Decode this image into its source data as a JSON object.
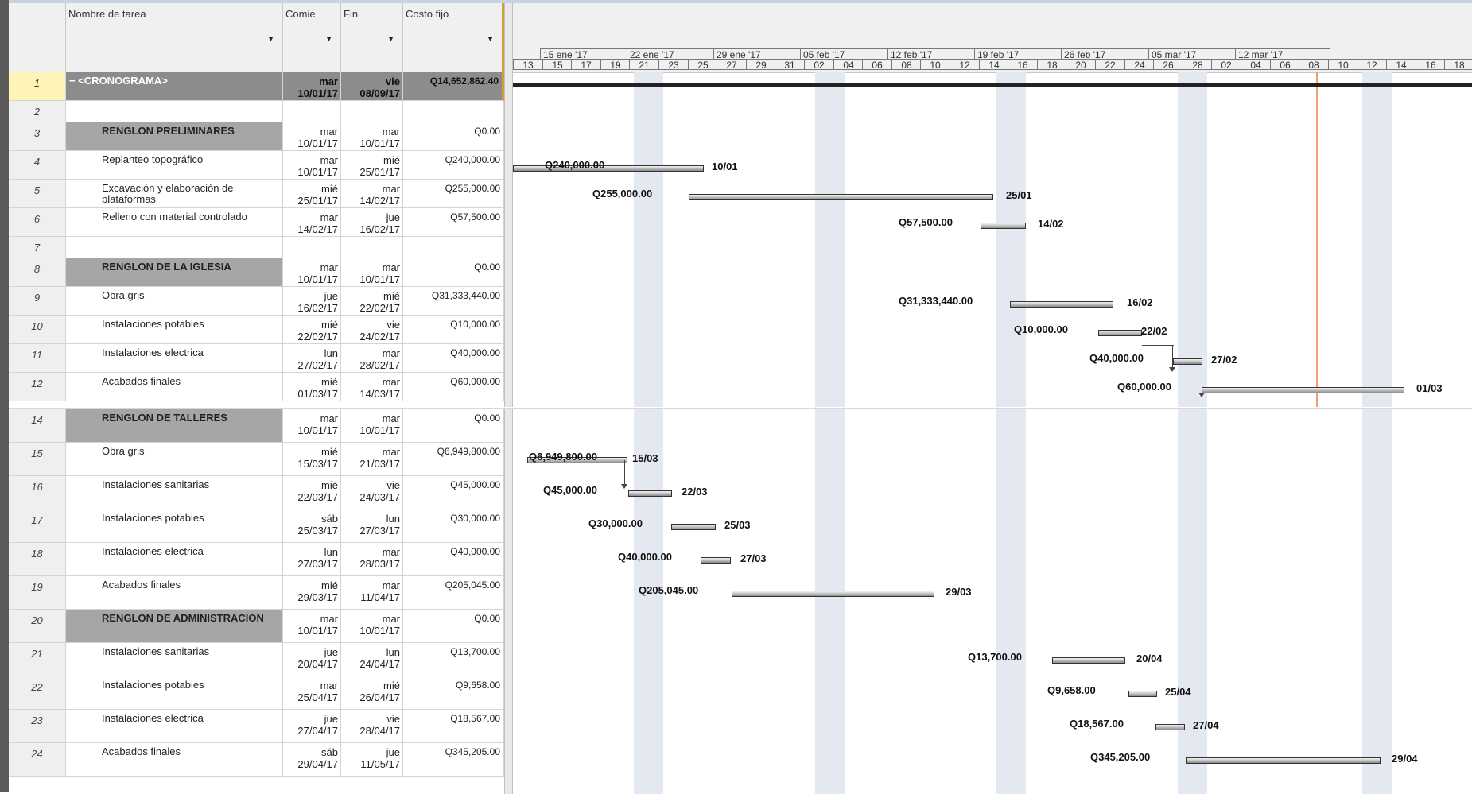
{
  "columns": {
    "name": "Nombre de tarea",
    "start": "Comie",
    "end": "Fin",
    "cost": "Costo fijo"
  },
  "timescale": {
    "weeks": [
      "15 ene '17",
      "22 ene '17",
      "29 ene '17",
      "05 feb '17",
      "12 feb '17",
      "19 feb '17",
      "26 feb '17",
      "05 mar '17",
      "12 mar '17"
    ],
    "days": [
      "13",
      "15",
      "17",
      "19",
      "21",
      "23",
      "25",
      "27",
      "29",
      "31",
      "02",
      "04",
      "06",
      "08",
      "10",
      "12",
      "14",
      "16",
      "18",
      "20",
      "22",
      "24",
      "26",
      "28",
      "02",
      "04",
      "06",
      "08",
      "10",
      "12",
      "14",
      "16",
      "18"
    ]
  },
  "top_rows": [
    {
      "id": "1",
      "name": "− <CRONOGRAMA>",
      "start": "mar",
      "start_date": "10/01/17",
      "end": "vie",
      "end_date": "08/09/17",
      "cost": "Q14,652,862.40",
      "kind": "top",
      "label": "",
      "tail": ""
    },
    {
      "id": "2",
      "name": "",
      "start": "",
      "start_date": "",
      "end": "",
      "end_date": "",
      "cost": "",
      "kind": "blank",
      "label": "",
      "tail": ""
    },
    {
      "id": "3",
      "name": "RENGLON PRELIMINARES",
      "start": "mar",
      "start_date": "10/01/17",
      "end": "mar",
      "end_date": "10/01/17",
      "cost": "Q0.00",
      "kind": "summary",
      "label": "",
      "tail": ""
    },
    {
      "id": "4",
      "name": "Replanteo topográfico",
      "start": "mar",
      "start_date": "10/01/17",
      "end": "mié",
      "end_date": "25/01/17",
      "cost": "Q240,000.00",
      "kind": "task",
      "label": "Q240,000.00",
      "tail": "10/01"
    },
    {
      "id": "5",
      "name": "Excavación y elaboración de plataformas",
      "start": "mié",
      "start_date": "25/01/17",
      "end": "mar",
      "end_date": "14/02/17",
      "cost": "Q255,000.00",
      "kind": "task",
      "label": "Q255,000.00",
      "tail": "25/01"
    },
    {
      "id": "6",
      "name": "Relleno con material controlado",
      "start": "mar",
      "start_date": "14/02/17",
      "end": "jue",
      "end_date": "16/02/17",
      "cost": "Q57,500.00",
      "kind": "task",
      "label": "Q57,500.00",
      "tail": "14/02"
    },
    {
      "id": "7",
      "name": "",
      "start": "",
      "start_date": "",
      "end": "",
      "end_date": "",
      "cost": "",
      "kind": "blank",
      "label": "",
      "tail": ""
    },
    {
      "id": "8",
      "name": "RENGLON DE LA IGLESIA",
      "start": "mar",
      "start_date": "10/01/17",
      "end": "mar",
      "end_date": "10/01/17",
      "cost": "Q0.00",
      "kind": "summary",
      "label": "",
      "tail": ""
    },
    {
      "id": "9",
      "name": "Obra gris",
      "start": "jue",
      "start_date": "16/02/17",
      "end": "mié",
      "end_date": "22/02/17",
      "cost": "Q31,333,440.00",
      "kind": "task",
      "label": "Q31,333,440.00",
      "tail": "16/02"
    },
    {
      "id": "10",
      "name": "Instalaciones potables",
      "start": "mié",
      "start_date": "22/02/17",
      "end": "vie",
      "end_date": "24/02/17",
      "cost": "Q10,000.00",
      "kind": "task",
      "label": "Q10,000.00",
      "tail": "22/02"
    },
    {
      "id": "11",
      "name": "Instalaciones electrica",
      "start": "lun",
      "start_date": "27/02/17",
      "end": "mar",
      "end_date": "28/02/17",
      "cost": "Q40,000.00",
      "kind": "task",
      "label": "Q40,000.00",
      "tail": "27/02"
    },
    {
      "id": "12",
      "name": "Acabados finales",
      "start": "mié",
      "start_date": "01/03/17",
      "end": "mar",
      "end_date": "14/03/17",
      "cost": "Q60,000.00",
      "kind": "task",
      "label": "Q60,000.00",
      "tail": "01/03"
    }
  ],
  "bottom_rows": [
    {
      "id": "14",
      "name": "RENGLON DE TALLERES",
      "start": "mar",
      "start_date": "10/01/17",
      "end": "mar",
      "end_date": "10/01/17",
      "cost": "Q0.00",
      "kind": "summary",
      "label": "",
      "tail": ""
    },
    {
      "id": "15",
      "name": "Obra gris",
      "start": "mié",
      "start_date": "15/03/17",
      "end": "mar",
      "end_date": "21/03/17",
      "cost": "Q6,949,800.00",
      "kind": "task",
      "label": "Q6,949,800.00",
      "tail": "15/03"
    },
    {
      "id": "16",
      "name": "Instalaciones sanitarias",
      "start": "mié",
      "start_date": "22/03/17",
      "end": "vie",
      "end_date": "24/03/17",
      "cost": "Q45,000.00",
      "kind": "task",
      "label": "Q45,000.00",
      "tail": "22/03"
    },
    {
      "id": "17",
      "name": "Instalaciones potables",
      "start": "sáb",
      "start_date": "25/03/17",
      "end": "lun",
      "end_date": "27/03/17",
      "cost": "Q30,000.00",
      "kind": "task",
      "label": "Q30,000.00",
      "tail": "25/03"
    },
    {
      "id": "18",
      "name": "Instalaciones electrica",
      "start": "lun",
      "start_date": "27/03/17",
      "end": "mar",
      "end_date": "28/03/17",
      "cost": "Q40,000.00",
      "kind": "task",
      "label": "Q40,000.00",
      "tail": "27/03"
    },
    {
      "id": "19",
      "name": "Acabados finales",
      "start": "mié",
      "start_date": "29/03/17",
      "end": "mar",
      "end_date": "11/04/17",
      "cost": "Q205,045.00",
      "kind": "task",
      "label": "Q205,045.00",
      "tail": "29/03"
    },
    {
      "id": "20",
      "name": "RENGLON DE ADMINISTRACION",
      "start": "mar",
      "start_date": "10/01/17",
      "end": "mar",
      "end_date": "10/01/17",
      "cost": "Q0.00",
      "kind": "summary",
      "label": "",
      "tail": ""
    },
    {
      "id": "21",
      "name": "Instalaciones sanitarias",
      "start": "jue",
      "start_date": "20/04/17",
      "end": "lun",
      "end_date": "24/04/17",
      "cost": "Q13,700.00",
      "kind": "task",
      "label": "Q13,700.00",
      "tail": "20/04"
    },
    {
      "id": "22",
      "name": "Instalaciones potables",
      "start": "mar",
      "start_date": "25/04/17",
      "end": "mié",
      "end_date": "26/04/17",
      "cost": "Q9,658.00",
      "kind": "task",
      "label": "Q9,658.00",
      "tail": "25/04"
    },
    {
      "id": "23",
      "name": "Instalaciones electrica",
      "start": "jue",
      "start_date": "27/04/17",
      "end": "vie",
      "end_date": "28/04/17",
      "cost": "Q18,567.00",
      "kind": "task",
      "label": "Q18,567.00",
      "tail": "27/04"
    },
    {
      "id": "24",
      "name": "Acabados finales",
      "start": "sáb",
      "start_date": "29/04/17",
      "end": "jue",
      "end_date": "11/05/17",
      "cost": "Q345,205.00",
      "kind": "task",
      "label": "Q345,205.00",
      "tail": "29/04"
    }
  ],
  "colors": {
    "summary_fill": "#a6a6a6",
    "top_fill": "#8c8c8c",
    "nonworking": "#e4e9f1",
    "today_line": "#f0a070"
  }
}
